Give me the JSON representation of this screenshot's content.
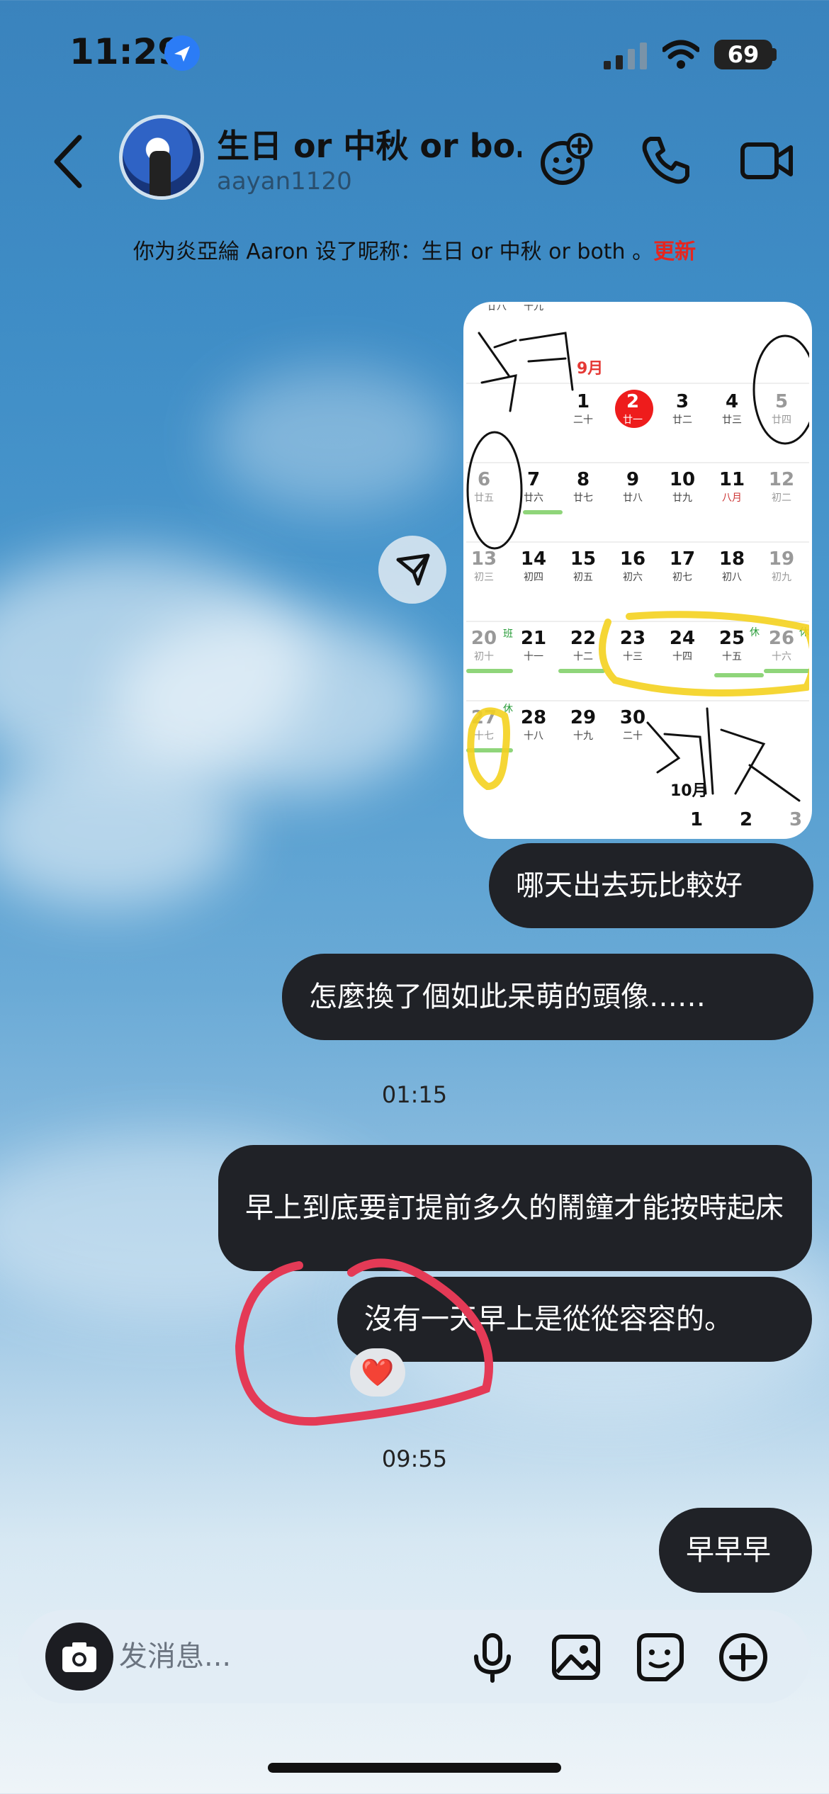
{
  "status_bar": {
    "time": "11:29",
    "battery": "69",
    "icons": [
      "location-arrow-icon",
      "signal-icon",
      "wifi-icon",
      "battery-icon"
    ]
  },
  "header": {
    "title": "生日 or 中秋 or bo…",
    "username": "aayan1120",
    "icons": [
      "back-icon",
      "effects-icon",
      "phone-icon",
      "video-icon"
    ]
  },
  "notice": {
    "text": "你为炎亞綸 Aaron 设了昵称：生日 or 中秋 or both 。",
    "link": "更新"
  },
  "calendar_image": {
    "top_partial": [
      "廿八",
      "十九"
    ],
    "month_label": "9月",
    "next_month_label": "10月",
    "handwriting": [
      "生日",
      "中秋"
    ],
    "rows": [
      [
        {
          "d": "1",
          "l": "二十"
        },
        {
          "d": "2",
          "l": "廿一"
        },
        {
          "d": "3",
          "l": "廿二"
        },
        {
          "d": "4",
          "l": "廿三"
        },
        {
          "d": "5",
          "l": "廿四"
        }
      ],
      [
        {
          "d": "6",
          "l": "廿五"
        },
        {
          "d": "7",
          "l": "廿六"
        },
        {
          "d": "8",
          "l": "廿七"
        },
        {
          "d": "9",
          "l": "廿八"
        },
        {
          "d": "10",
          "l": "廿九"
        },
        {
          "d": "11",
          "l": "八月"
        },
        {
          "d": "12",
          "l": "初二"
        }
      ],
      [
        {
          "d": "13",
          "l": "初三"
        },
        {
          "d": "14",
          "l": "初四"
        },
        {
          "d": "15",
          "l": "初五"
        },
        {
          "d": "16",
          "l": "初六"
        },
        {
          "d": "17",
          "l": "初七"
        },
        {
          "d": "18",
          "l": "初八"
        },
        {
          "d": "19",
          "l": "初九"
        }
      ],
      [
        {
          "d": "20",
          "l": "初十"
        },
        {
          "d": "21",
          "l": "十一"
        },
        {
          "d": "22",
          "l": "十二"
        },
        {
          "d": "23",
          "l": "十三"
        },
        {
          "d": "24",
          "l": "十四"
        },
        {
          "d": "25",
          "l": "十五"
        },
        {
          "d": "26",
          "l": "十六"
        }
      ],
      [
        {
          "d": "27",
          "l": "十七"
        },
        {
          "d": "28",
          "l": "十八"
        },
        {
          "d": "29",
          "l": "十九"
        },
        {
          "d": "30",
          "l": "二十"
        }
      ]
    ],
    "tags": {
      "ban": "班",
      "xiu": "休"
    },
    "next_row": [
      "1",
      "2",
      "3"
    ]
  },
  "messages": [
    {
      "text": "哪天出去玩比較好"
    },
    {
      "text": "怎麼換了個如此呆萌的頭像……"
    },
    {
      "timestamp": "01:15"
    },
    {
      "text": "早上到底要訂提前多久的鬧鐘才能按時起床"
    },
    {
      "text": "沒有一天早上是從從容容的。",
      "reaction": "❤️"
    },
    {
      "timestamp": "09:55"
    },
    {
      "text": "早早早"
    }
  ],
  "composer": {
    "placeholder": "发消息...",
    "icons": [
      "camera-icon",
      "microphone-icon",
      "gallery-icon",
      "sticker-icon",
      "add-icon"
    ]
  }
}
